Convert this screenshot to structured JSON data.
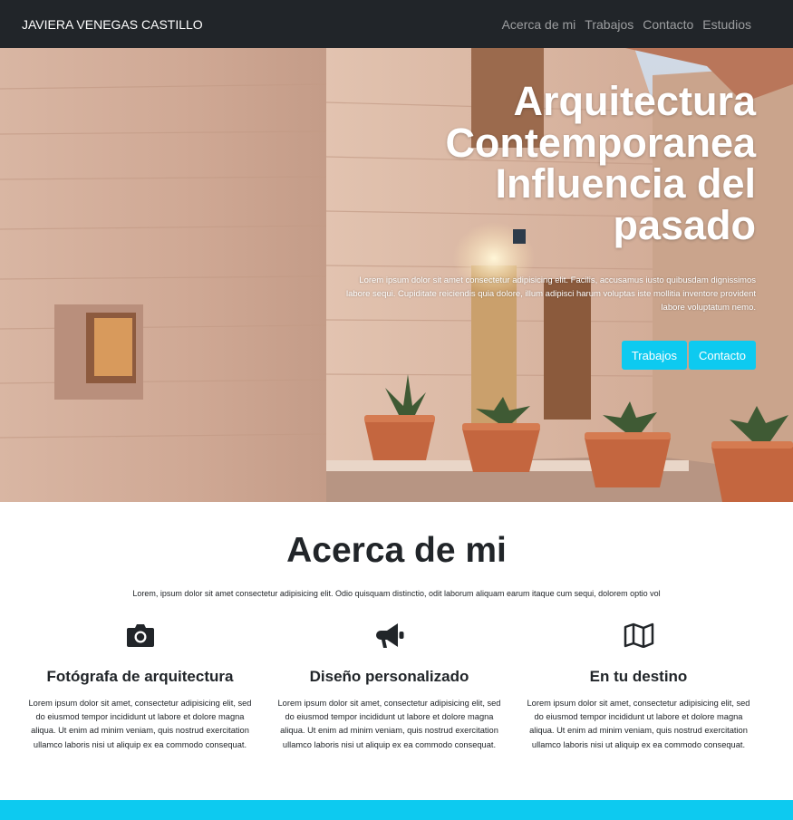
{
  "navbar": {
    "brand": "JAVIERA VENEGAS CASTILLO",
    "links": [
      "Acerca de mi",
      "Trabajos",
      "Contacto",
      "Estudios"
    ]
  },
  "hero": {
    "title_lines": [
      "Arquitectura",
      "Contemporanea",
      "Influencia del",
      "pasado"
    ],
    "text": "Lorem ipsum dolor sit amet consectetur adipisicing elit. Facilis, accusamus iusto quibusdam dignissimos labore sequi. Cupiditate reiciendis quia dolore, illum adipisci harum voluptas iste mollitia inventore provident labore voluptatum nemo.",
    "buttons": [
      "Trabajos",
      "Contacto"
    ]
  },
  "about": {
    "title": "Acerca de mi",
    "lead": "Lorem, ipsum dolor sit amet consectetur adipisicing elit. Odio quisquam distinctio, odit laborum aliquam earum itaque cum sequi, dolorem optio vol",
    "features": [
      {
        "icon": "camera-icon",
        "title": "Fotógrafa de arquitectura",
        "text": "Lorem ipsum dolor sit amet, consectetur adipisicing elit, sed do eiusmod tempor incididunt ut labore et dolore magna aliqua. Ut enim ad minim veniam, quis nostrud exercitation ullamco laboris nisi ut aliquip ex ea commodo consequat."
      },
      {
        "icon": "megaphone-icon",
        "title": "Diseño personalizado",
        "text": "Lorem ipsum dolor sit amet, consectetur adipisicing elit, sed do eiusmod tempor incididunt ut labore et dolore magna aliqua. Ut enim ad minim veniam, quis nostrud exercitation ullamco laboris nisi ut aliquip ex ea commodo consequat."
      },
      {
        "icon": "map-icon",
        "title": "En tu destino",
        "text": "Lorem ipsum dolor sit amet, consectetur adipisicing elit, sed do eiusmod tempor incididunt ut labore et dolore magna aliqua. Ut enim ad minim veniam, quis nostrud exercitation ullamco laboris nisi ut aliquip ex ea commodo consequat."
      }
    ]
  },
  "colors": {
    "navbar": "#212529",
    "accent": "#0dcaf0"
  }
}
